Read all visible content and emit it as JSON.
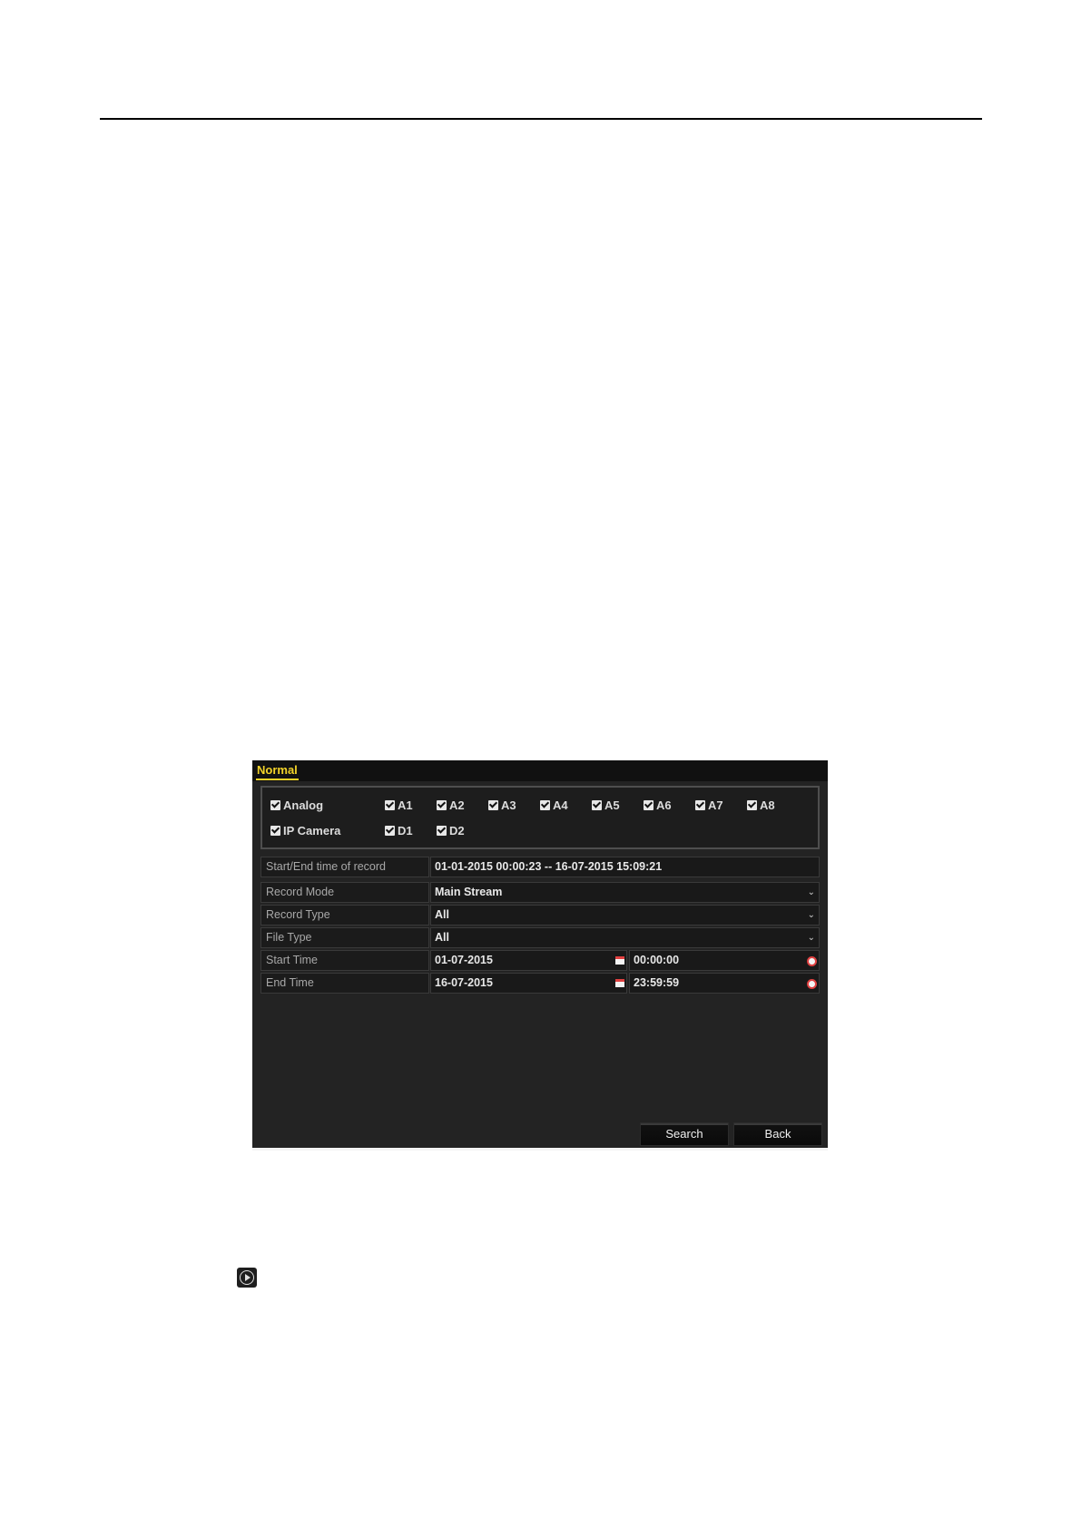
{
  "dialog": {
    "tab_label": "Normal",
    "channels": {
      "analog": {
        "group_label": "Analog",
        "items": [
          "A1",
          "A2",
          "A3",
          "A4",
          "A5",
          "A6",
          "A7",
          "A8"
        ]
      },
      "ip": {
        "group_label": "IP Camera",
        "items": [
          "D1",
          "D2"
        ]
      }
    },
    "fields": {
      "record_range": {
        "label": "Start/End time of record",
        "value": "01-01-2015 00:00:23 -- 16-07-2015 15:09:21"
      },
      "record_mode": {
        "label": "Record Mode",
        "value": "Main Stream"
      },
      "record_type": {
        "label": "Record Type",
        "value": "All"
      },
      "file_type": {
        "label": "File Type",
        "value": "All"
      },
      "start_time": {
        "label": "Start Time",
        "date": "01-07-2015",
        "time": "00:00:00"
      },
      "end_time": {
        "label": "End Time",
        "date": "16-07-2015",
        "time": "23:59:59"
      }
    },
    "buttons": {
      "search": "Search",
      "back": "Back"
    }
  },
  "icons": {
    "checkbox": "checkbox-checked-icon",
    "dropdown": "chevron-down-icon",
    "calendar": "calendar-icon",
    "clock": "clock-icon",
    "play": "play-icon"
  },
  "colors": {
    "tab_accent": "#f2d229",
    "panel_bg": "#232323"
  }
}
